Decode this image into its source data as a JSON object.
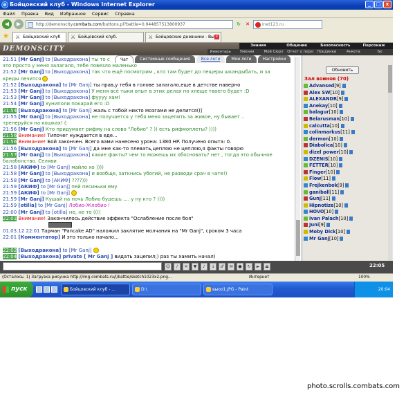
{
  "window": {
    "title": "Бойцовский клуб - Windows Internet Explorer",
    "controls": [
      "_",
      "□",
      "x"
    ]
  },
  "menu": [
    "Файл",
    "Правка",
    "Вид",
    "Избранное",
    "Сервис",
    "Справка"
  ],
  "address": {
    "prefix": "http://demonscity.",
    "domain": "combats.com",
    "rest": "/buttons.pl?battle=0.944857513800937",
    "search": "Inet123.ru"
  },
  "tabs": [
    {
      "label": "Бойцовский клуб",
      "active": true
    },
    {
      "label": "Бойцовский клуб.",
      "active": false
    },
    {
      "label": "Бойцовские дневники - Вы...",
      "active": false
    }
  ],
  "game": {
    "logo": "DEMONSCITY",
    "topnav": [
      "Знания",
      "Общение",
      "Безопасность",
      "Персонаж"
    ],
    "subnav": [
      "Инвентарь",
      "Умения",
      "Мой Сюрл",
      "Отчет о переводах",
      "Поединки",
      "Анкета",
      "Бе"
    ]
  },
  "chat_tabs": {
    "chat": "Чат",
    "system": "Системные сообщения",
    "all_logs": "Все логи",
    "my_logs": "Мои логи",
    "settings": "Настройки"
  },
  "chat_lines": [
    {
      "time": "21:51",
      "nick": "[Mr Ganj]",
      "to": "to [Выходракона]",
      "text": "ты то с",
      "cls": "gr"
    },
    {
      "time": "",
      "nick": "",
      "to": "",
      "text": "это просто у меня залагало, тебе повезло маленько",
      "cls": "gr"
    },
    {
      "time": "21:52",
      "nick": "[Mr Ganj]",
      "to": "to [Выходракона]",
      "text": "так что ещё посмотрим , кто там будет до пещеры шкандыбать, и за",
      "cls": "gr"
    },
    {
      "time": "",
      "nick": "",
      "to": "",
      "text": "креды лечится",
      "cls": "gr",
      "emo": true
    },
    {
      "time": "21:52",
      "nick": "[Выходракона]",
      "to": "to [Mr Ganj]",
      "text": "ты прав,у тебя в голове залагало,еще в детстве наверно",
      "cls": "bl"
    },
    {
      "time": "21:53",
      "nick": "[Mr Ganj]",
      "to": "to [Выходракона]",
      "text": "У меня всё тыки опыт в этих делах по хлеще твоего будет :D",
      "cls": "gr"
    },
    {
      "time": "21:53",
      "nick": "[Mr Ganj]",
      "to": "to [Выходракона]",
      "text": "фуууу хам!",
      "cls": "gr"
    },
    {
      "time": "21:54",
      "nick": "[Mr Ganj]",
      "to": "",
      "text": "хуниполи покарай его :D",
      "cls": "gr"
    },
    {
      "time": "21:54",
      "nick": "[Выходракона]",
      "to": "to [Mr Ganj]",
      "text": "жаль с тобой никто мозгами не делится(((",
      "cls": "bl",
      "hl": true
    },
    {
      "time": "21:55",
      "nick": "[Mr Ganj]",
      "to": "to [Выходракона]",
      "text": "не получается у тебя меня зацепить за живое, ну бывает ..",
      "cls": "gr"
    },
    {
      "time": "",
      "nick": "",
      "to": "",
      "text": "тренеруйся на кошках! (:",
      "cls": "gr"
    },
    {
      "time": "21:56",
      "nick": "[Mr Ganj]",
      "to": "",
      "text": "Кто придумает рифму на слово \"Лобио\" ? )) есть рифмоплеты? ))))",
      "cls": "gr"
    },
    {
      "time": "21:56",
      "nick": "",
      "to": "",
      "sys": "Внимание!",
      "text": "Типочег нуждается в еде...",
      "cls": "bl",
      "hl": true
    },
    {
      "time": "21:56",
      "nick": "",
      "to": "",
      "sys": "Внимание!",
      "text": "Бой закончен. Всего вами нанесено урона: 1380 HP. Получено опыта: 0.",
      "cls": "bl",
      "hl": true
    },
    {
      "time": "21:56",
      "nick": "[Выходракона]",
      "to": "to [Mr Ganj]",
      "text": "да мне как-то плевать,цепляю не цепляю,я факты говорю",
      "cls": "bl"
    },
    {
      "time": "21:57",
      "nick": "[Mr Ganj]",
      "to": "to [Выходракона]",
      "text": "какие факты? чем то можешь их обосновать? нет , тогда это обычное",
      "cls": "gr",
      "hl": true
    },
    {
      "time": "",
      "nick": "",
      "to": "",
      "text": "балаболство. Селяви",
      "cls": "gr"
    },
    {
      "time": "21:58",
      "nick": "[АКИФ]",
      "to": "to [Mr Ganj]",
      "text": "майло хо ))))",
      "cls": "gr"
    },
    {
      "time": "21:58",
      "nick": "[Mr Ganj]",
      "to": "to [Выходракона]",
      "text": "и вообще, заткнись убогий, не разводи срач в чате!)",
      "cls": "gr"
    },
    {
      "time": "21:58",
      "nick": "[Mr Ganj]",
      "to": "to [АКИФ]",
      "text": "????)))",
      "cls": "gr"
    },
    {
      "time": "21:59",
      "nick": "[АКИФ]",
      "to": "to [Mr Ganj]",
      "text": "пей песиньки ему",
      "cls": "gr"
    },
    {
      "time": "21:59",
      "nick": "[АКИФ]",
      "to": "to [Mr Ganj]",
      "text": "",
      "cls": "gr",
      "emo": true
    },
    {
      "time": "21:59",
      "nick": "[Mr Ganj]",
      "to": "",
      "text": "Кушай на ночь Лобио будешь .... у ну кто ? ))))",
      "cls": "gr"
    },
    {
      "time": "21:59",
      "nick": "[otilla]",
      "to": "to [Mr Ganj]",
      "text": "Лобио-Жлобио !",
      "cls": "pk"
    },
    {
      "time": "22:00",
      "nick": "[Mr Ganj]",
      "to": "to [otilla]",
      "text": "не, не то ((((",
      "cls": "gr"
    },
    {
      "time": "22:01",
      "nick": "",
      "to": "",
      "sys": "Внимание!",
      "text": "Закончилось действие эффекта \"Ослабление после боя\"",
      "cls": "bl",
      "hl": true
    },
    {
      "time": "",
      "nick": "",
      "to": "",
      "text": "",
      "cls": "bl",
      "img": true
    },
    {
      "time": "01.03.12 22:01",
      "nick": "",
      "to": "",
      "text": "Тарман \"Pancake AD\" наложил заклятие молчания на \"Mr Ganj\", сроком 3 часа",
      "cls": "bl",
      "img2": true
    },
    {
      "time": "22:01",
      "nick": "[Комментатор]",
      "to": "",
      "text": "И это только начало...",
      "cls": "bl"
    },
    {
      "time": "",
      "nick": "",
      "to": "",
      "text": "",
      "cls": "bl"
    },
    {
      "time": "22:02",
      "nick": "[Выходракона]",
      "to": "to [Mr Ganj]",
      "text": "",
      "cls": "bl",
      "emo": true,
      "hl": true
    },
    {
      "time": "22:04",
      "nick": "[Выходракона]",
      "to": "private [ Mr Ganj ]",
      "text": "видать зацепил;) раз ты хамить начал)",
      "cls": "bl",
      "hl": true,
      "priv": true
    }
  ],
  "side": {
    "refresh": "Обновить",
    "title": "Зал воинов (70)",
    "players": [
      {
        "name": "Advansed",
        "lvl": "[9]"
      },
      {
        "name": "Alex SW",
        "lvl": "[10]"
      },
      {
        "name": "ALEXANDR",
        "lvl": "[9]"
      },
      {
        "name": "Anekay",
        "lvl": "[10]"
      },
      {
        "name": "balagur",
        "lvl": "[10]"
      },
      {
        "name": "Belarusman",
        "lvl": "[10]"
      },
      {
        "name": "calcutta",
        "lvl": "[10]"
      },
      {
        "name": "colinmarkus",
        "lvl": "[11]"
      },
      {
        "name": "dermon",
        "lvl": "[10]"
      },
      {
        "name": "Diabolica",
        "lvl": "[10]"
      },
      {
        "name": "dizel power",
        "lvl": "[10]"
      },
      {
        "name": "DZENIS",
        "lvl": "[10]"
      },
      {
        "name": "FETTER",
        "lvl": "[10]"
      },
      {
        "name": "Finger",
        "lvl": "[10]"
      },
      {
        "name": "Flow",
        "lvl": "[11]"
      },
      {
        "name": "Frejkenbok",
        "lvl": "[9]"
      },
      {
        "name": "ganiball",
        "lvl": "[11]"
      },
      {
        "name": "Gunj",
        "lvl": "[11]"
      },
      {
        "name": "Hipnotize",
        "lvl": "[10]"
      },
      {
        "name": "HOVO",
        "lvl": "[10]"
      },
      {
        "name": "Ivan Palach",
        "lvl": "[10]"
      },
      {
        "name": "Juni",
        "lvl": "[9]"
      },
      {
        "name": "Moby Dick",
        "lvl": "[10]"
      },
      {
        "name": "Mr Ganj",
        "lvl": "[10]"
      }
    ]
  },
  "bottom": {
    "clock": "22:05"
  },
  "status": {
    "text": "(Осталось: 1) Загрузка рисунка http://img.combats.ru/i/battle/sketch1023x2.png...",
    "zone": "Интернет",
    "zoom": "100%"
  },
  "taskbar": {
    "start": "пуск",
    "items": [
      "Бойцовский клуб - ...",
      "D:\\",
      "выоо1.JPG - Paint"
    ],
    "lang": "EN",
    "time": "20:04"
  },
  "caption": "photo.scrolls.combats.com"
}
